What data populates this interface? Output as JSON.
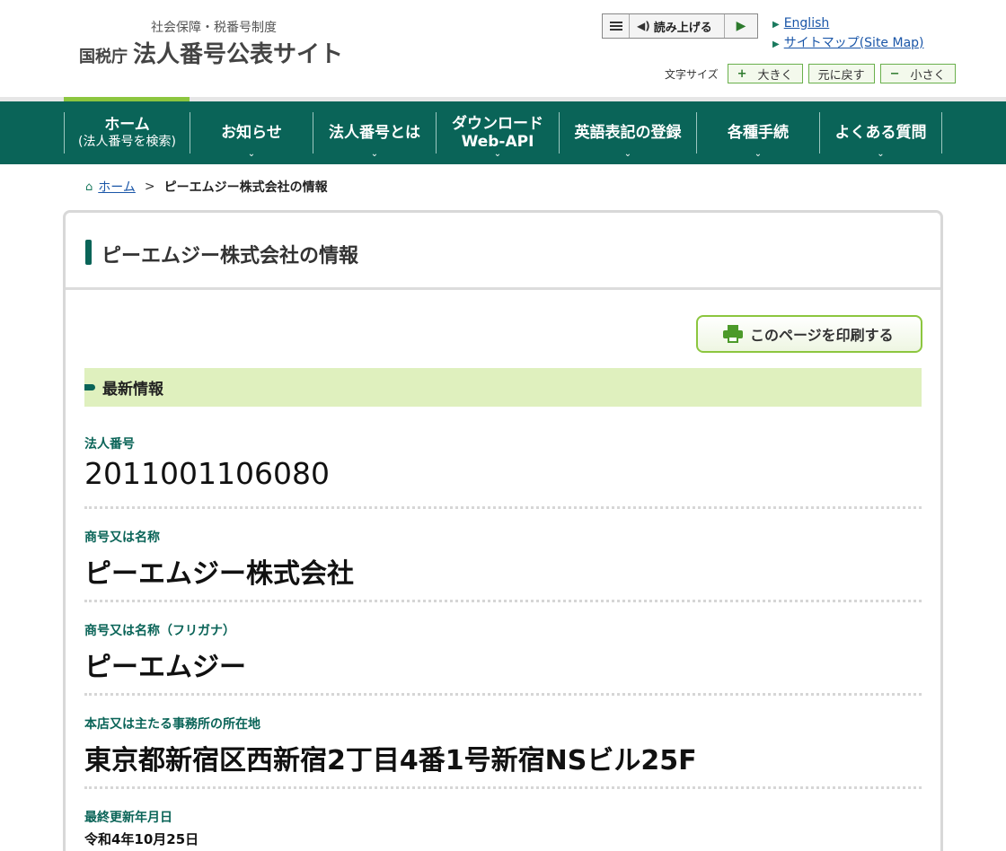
{
  "header": {
    "logo_sub": "社会保障・税番号制度",
    "logo_agency": "国税庁",
    "logo_title": "法人番号公表サイト",
    "read_aloud_label": "読み上げる",
    "links": [
      {
        "label": "English"
      },
      {
        "label": "サイトマップ(Site Map)"
      }
    ],
    "font_size": {
      "label": "文字サイズ",
      "bigger": "大きく",
      "reset": "元に戻す",
      "smaller": "小さく"
    }
  },
  "nav": [
    {
      "label": "ホーム",
      "label2": "(法人番号を検索)"
    },
    {
      "label": "お知らせ"
    },
    {
      "label": "法人番号とは"
    },
    {
      "label": "ダウンロード",
      "label2": "Web-API"
    },
    {
      "label": "英語表記の登録"
    },
    {
      "label": "各種手続"
    },
    {
      "label": "よくある質問"
    }
  ],
  "breadcrumb": {
    "home": "ホーム",
    "separator": ">",
    "current": "ピーエムジー株式会社の情報"
  },
  "panel": {
    "title": "ピーエムジー株式会社の情報",
    "print_label": "このページを印刷する",
    "section_title": "最新情報",
    "fields": [
      {
        "label": "法人番号",
        "value": "2011001106080"
      },
      {
        "label": "商号又は名称",
        "value": "ピーエムジー株式会社"
      },
      {
        "label": "商号又は名称（フリガナ）",
        "value": "ピーエムジー"
      },
      {
        "label": "本店又は主たる事務所の所在地",
        "value": "東京都新宿区西新宿2丁目4番1号新宿NSビル25F"
      },
      {
        "label": "最終更新年月日",
        "value": "令和4年10月25日"
      }
    ]
  },
  "colors": {
    "brand_green": "#0a6458",
    "accent_light_green": "#8cc63f",
    "section_bg": "#dff0be",
    "link_blue": "#1a56a8"
  }
}
